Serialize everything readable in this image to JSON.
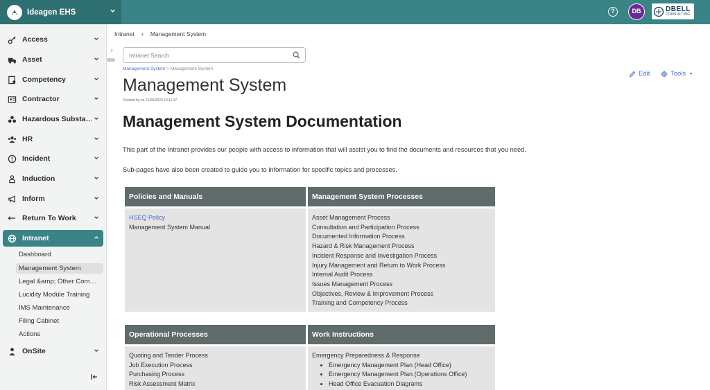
{
  "app": {
    "name": "Ideagen EHS",
    "avatar_initials": "DB",
    "org_logo_line1": "DBELL",
    "org_logo_line2": "CONSULTING",
    "colors": {
      "header": "#3a8386",
      "brand_bg": "#2e6f72",
      "active_nav": "#3a8386",
      "avatar": "#6a2a93",
      "link": "#4a6fd0",
      "table_header": "#606b6b",
      "table_body": "#e4e4e4"
    }
  },
  "sidebar": {
    "items": [
      {
        "label": "Access",
        "icon": "key-icon"
      },
      {
        "label": "Asset",
        "icon": "truck-icon"
      },
      {
        "label": "Competency",
        "icon": "certificate-icon"
      },
      {
        "label": "Contractor",
        "icon": "id-card-icon"
      },
      {
        "label": "Hazardous Substa…",
        "icon": "biohazard-icon"
      },
      {
        "label": "HR",
        "icon": "people-icon"
      },
      {
        "label": "Incident",
        "icon": "alert-circle-icon"
      },
      {
        "label": "Induction",
        "icon": "person-badge-icon"
      },
      {
        "label": "Inform",
        "icon": "megaphone-icon"
      },
      {
        "label": "Return To Work",
        "icon": "return-arrow-icon"
      },
      {
        "label": "Intranet",
        "icon": "globe-icon"
      },
      {
        "label": "OnSite",
        "icon": "person-icon"
      }
    ],
    "intranet_sub_items": [
      "Dashboard",
      "Management System",
      "Legal &amp; Other Com…",
      "Lucidity Module Training",
      "IMS Maintenance",
      "Filing Cabinet",
      "Actions"
    ]
  },
  "breadcrumb_top": [
    "Intranet",
    "Management System"
  ],
  "search": {
    "placeholder": "Intranet Search"
  },
  "breadcrumb_small": {
    "parent": "Management System",
    "current": "Management System"
  },
  "page": {
    "title": "Management System",
    "created": "Created by on 21/06/2023 13:11:17",
    "edit_label": "Edit",
    "tools_label": "Tools",
    "heading": "Management System Documentation",
    "para1": "This part of the Intranet provides our people with access to information that will assist you to find the documents and resources that you need.",
    "para2": "Sub-pages have also been created to guide you to information for specific topics and processes."
  },
  "tables": {
    "policies": {
      "header": "Policies and Manuals",
      "link": "HSEQ Policy",
      "items": [
        "Management System Manual"
      ]
    },
    "processes": {
      "header": "Management System Processes",
      "items": [
        "Asset Management Process",
        "Consultation and Participation Process",
        "Documented Information Process",
        "Hazard & Risk Management Process",
        "Incident Response and Investigation Process",
        "Injury Management and Return to Work Process",
        "Internal Audit Process",
        "Issues Management Process",
        "Objectives, Review & Improvement Process",
        "Training and Competency Process"
      ]
    },
    "operational": {
      "header": "Operational Processes",
      "items": [
        "Quoting and Tender Process",
        "Job Execution Process",
        "Purchasing Process",
        "Risk Assessment Matrix"
      ]
    },
    "work_instructions": {
      "header": "Work Instructions",
      "intro": "Emergency Preparedness & Response",
      "bullets": [
        "Emergency Management Plan (Head Office)",
        "Emergency Management Plan (Operations Office)",
        "Head Office Evacuation Diagrams"
      ]
    }
  }
}
